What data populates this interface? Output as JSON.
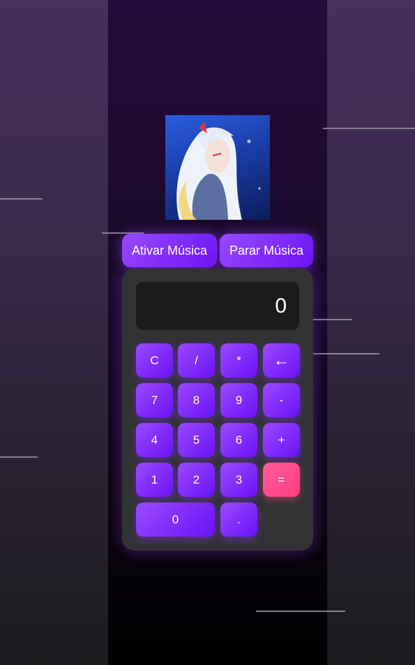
{
  "music": {
    "play_label": "Ativar Música",
    "stop_label": "Parar Música"
  },
  "calculator": {
    "display_value": "0",
    "keys": {
      "clear": "C",
      "divide": "/",
      "multiply": "*",
      "backspace": "←",
      "seven": "7",
      "eight": "8",
      "nine": "9",
      "minus": "-",
      "four": "4",
      "five": "5",
      "six": "6",
      "plus": "+",
      "one": "1",
      "two": "2",
      "three": "3",
      "equals": "=",
      "zero": "0",
      "dot": "."
    }
  },
  "colors": {
    "accent": "#7b2cff",
    "equals": "#ff4d8d",
    "panel": "#333335",
    "display": "#1b1b1b"
  }
}
